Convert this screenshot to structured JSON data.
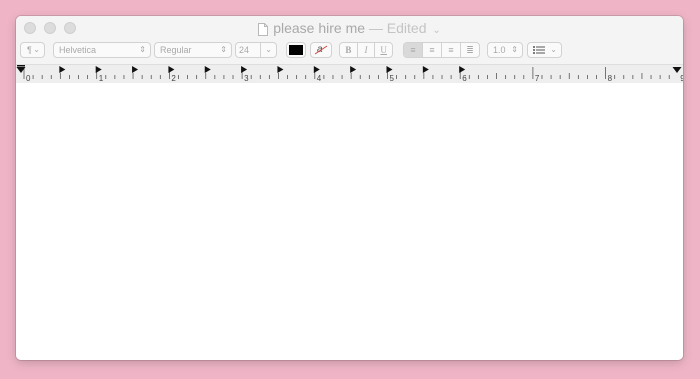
{
  "window": {
    "title": "please hire me",
    "status": "— Edited",
    "status_chevron": "⌄",
    "document_icon": "document-icon"
  },
  "toolbar": {
    "paragraph_styles_label": "¶",
    "font_family": "Helvetica",
    "font_typeface": "Regular",
    "font_size": "24",
    "text_color": "#000000",
    "highlight_label": "a",
    "bold_label": "B",
    "italic_label": "I",
    "underline_label": "U",
    "line_spacing": "1.0",
    "list_icon": "list-bullets-icon"
  },
  "ruler": {
    "numbers": [
      "0",
      "1",
      "2",
      "3",
      "4",
      "5",
      "6",
      "7",
      "8",
      "9"
    ]
  },
  "document": {
    "body_text": ""
  }
}
